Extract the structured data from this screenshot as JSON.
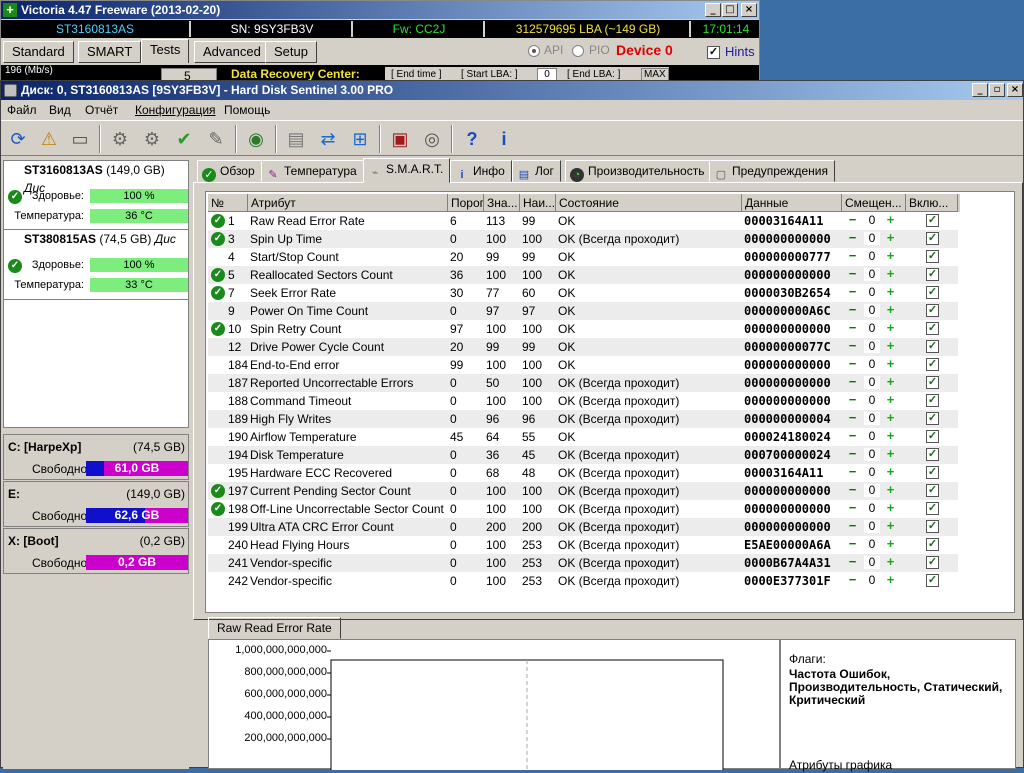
{
  "victoria": {
    "title": "Victoria 4.47  Freeware (2013-02-20)",
    "model": "ST3160813AS",
    "serial": "SN: 9SY3FB3V",
    "firmware": "Fw: CC2J",
    "lba": "312579695 LBA (~149 GB)",
    "time": "17:01:14",
    "tabs": [
      "Standard",
      "SMART",
      "Tests",
      "Advanced",
      "Setup"
    ],
    "active_tab": "Tests",
    "mode_api": "API",
    "mode_pio": "PIO",
    "device": "Device 0",
    "hints": "Hints",
    "speed_label": "196 (Mb/s)",
    "counter": "5",
    "data_recovery": "Data Recovery Center:",
    "end_time": "[ End time ]",
    "start_lba": "[ Start LBA: ]",
    "start_lba_val": "0",
    "end_lba": "[ End LBA: ]",
    "max": "MAX"
  },
  "hds": {
    "title": "Диск: 0, ST3160813AS [9SY3FB3V]  -  Hard Disk Sentinel 3.00 PRO",
    "menu": [
      "Файл",
      "Вид",
      "Отчёт",
      "Конфигурация",
      "Помощь"
    ],
    "tabs": [
      {
        "label": "Обзор",
        "icon": "check-icon"
      },
      {
        "label": "Температура",
        "icon": "thermometer-icon"
      },
      {
        "label": "S.M.A.R.T.",
        "icon": "smart-icon"
      },
      {
        "label": "Инфо",
        "icon": "info-icon"
      },
      {
        "label": "Лог",
        "icon": "log-icon"
      },
      {
        "label": "Производительность",
        "icon": "speed-icon"
      },
      {
        "label": "Предупреждения",
        "icon": "warning-icon"
      }
    ],
    "active_tab": "S.M.A.R.T.",
    "disks": [
      {
        "name": "ST3160813AS",
        "size": "(149,0 GB)",
        "extra": "Дис",
        "health_label": "Здоровье:",
        "health": "100 %",
        "temp_label": "Температура:",
        "temp": "36 °C"
      },
      {
        "name": "ST380815AS",
        "size": "(74,5 GB)",
        "extra": "Дис",
        "health_label": "Здоровье:",
        "health": "100 %",
        "temp_label": "Температура:",
        "temp": "33 °C"
      }
    ],
    "partitions": [
      {
        "letter": "C: [HarpeXp]",
        "size": "(74,5 GB)",
        "free_label": "Свободно",
        "free": "61,0 GB",
        "used_frac": 0.18
      },
      {
        "letter": "E:",
        "size": "(149,0 GB)",
        "free_label": "Свободно",
        "free": "62,6 GB",
        "used_frac": 0.58
      },
      {
        "letter": "X: [Boot]",
        "size": "(0,2 GB)",
        "free_label": "Свободно",
        "free": "0,2 GB",
        "used_frac": 0.0
      }
    ],
    "columns": [
      "№",
      "Атрибут",
      "Порог",
      "Зна...",
      "Наи...",
      "Состояние",
      "Данные",
      "Смещен...",
      "Вклю..."
    ],
    "rows": [
      {
        "ok": true,
        "id": "1",
        "name": "Raw Read Error Rate",
        "thr": "6",
        "val": "113",
        "worst": "99",
        "state": "OK",
        "data": "00003164A11",
        "off": "0"
      },
      {
        "ok": true,
        "id": "3",
        "name": "Spin Up Time",
        "thr": "0",
        "val": "100",
        "worst": "100",
        "state": "OK (Всегда проходит)",
        "data": "000000000000",
        "off": "0"
      },
      {
        "ok": false,
        "id": "4",
        "name": "Start/Stop Count",
        "thr": "20",
        "val": "99",
        "worst": "99",
        "state": "OK",
        "data": "000000000777",
        "off": "0"
      },
      {
        "ok": true,
        "id": "5",
        "name": "Reallocated Sectors Count",
        "thr": "36",
        "val": "100",
        "worst": "100",
        "state": "OK",
        "data": "000000000000",
        "off": "0"
      },
      {
        "ok": true,
        "id": "7",
        "name": "Seek Error Rate",
        "thr": "30",
        "val": "77",
        "worst": "60",
        "state": "OK",
        "data": "0000030B2654",
        "off": "0"
      },
      {
        "ok": false,
        "id": "9",
        "name": "Power On Time Count",
        "thr": "0",
        "val": "97",
        "worst": "97",
        "state": "OK",
        "data": "000000000A6C",
        "off": "0"
      },
      {
        "ok": true,
        "id": "10",
        "name": "Spin Retry Count",
        "thr": "97",
        "val": "100",
        "worst": "100",
        "state": "OK",
        "data": "000000000000",
        "off": "0"
      },
      {
        "ok": false,
        "id": "12",
        "name": "Drive Power Cycle Count",
        "thr": "20",
        "val": "99",
        "worst": "99",
        "state": "OK",
        "data": "00000000077C",
        "off": "0"
      },
      {
        "ok": false,
        "id": "184",
        "name": "End-to-End error",
        "thr": "99",
        "val": "100",
        "worst": "100",
        "state": "OK",
        "data": "000000000000",
        "off": "0"
      },
      {
        "ok": false,
        "id": "187",
        "name": "Reported Uncorrectable Errors",
        "thr": "0",
        "val": "50",
        "worst": "100",
        "state": "OK (Всегда проходит)",
        "data": "000000000000",
        "off": "0"
      },
      {
        "ok": false,
        "id": "188",
        "name": "Command Timeout",
        "thr": "0",
        "val": "100",
        "worst": "100",
        "state": "OK (Всегда проходит)",
        "data": "000000000000",
        "off": "0"
      },
      {
        "ok": false,
        "id": "189",
        "name": "High Fly Writes",
        "thr": "0",
        "val": "96",
        "worst": "96",
        "state": "OK (Всегда проходит)",
        "data": "000000000004",
        "off": "0"
      },
      {
        "ok": false,
        "id": "190",
        "name": "Airflow Temperature",
        "thr": "45",
        "val": "64",
        "worst": "55",
        "state": "OK",
        "data": "000024180024",
        "off": "0"
      },
      {
        "ok": false,
        "id": "194",
        "name": "Disk Temperature",
        "thr": "0",
        "val": "36",
        "worst": "45",
        "state": "OK (Всегда проходит)",
        "data": "000700000024",
        "off": "0"
      },
      {
        "ok": false,
        "id": "195",
        "name": "Hardware ECC Recovered",
        "thr": "0",
        "val": "68",
        "worst": "48",
        "state": "OK (Всегда проходит)",
        "data": "00003164A11",
        "off": "0"
      },
      {
        "ok": true,
        "id": "197",
        "name": "Current Pending Sector Count",
        "thr": "0",
        "val": "100",
        "worst": "100",
        "state": "OK (Всегда проходит)",
        "data": "000000000000",
        "off": "0"
      },
      {
        "ok": true,
        "id": "198",
        "name": "Off-Line Uncorrectable Sector Count",
        "thr": "0",
        "val": "100",
        "worst": "100",
        "state": "OK (Всегда проходит)",
        "data": "000000000000",
        "off": "0"
      },
      {
        "ok": false,
        "id": "199",
        "name": "Ultra ATA CRC Error Count",
        "thr": "0",
        "val": "200",
        "worst": "200",
        "state": "OK (Всегда проходит)",
        "data": "000000000000",
        "off": "0"
      },
      {
        "ok": false,
        "id": "240",
        "name": "Head Flying Hours",
        "thr": "0",
        "val": "100",
        "worst": "253",
        "state": "OK (Всегда проходит)",
        "data": "E5AE00000A6A",
        "off": "0"
      },
      {
        "ok": false,
        "id": "241",
        "name": "Vendor-specific",
        "thr": "0",
        "val": "100",
        "worst": "253",
        "state": "OK (Всегда проходит)",
        "data": "0000B67A4A31",
        "off": "0"
      },
      {
        "ok": false,
        "id": "242",
        "name": "Vendor-specific",
        "thr": "0",
        "val": "100",
        "worst": "253",
        "state": "OK (Всегда проходит)",
        "data": "0000E377301F",
        "off": "0"
      }
    ],
    "lower_tab": "Raw Read Error Rate",
    "chart_yticks": [
      "1,000,000,000,000",
      "800,000,000,000",
      "600,000,000,000",
      "400,000,000,000",
      "200,000,000,000"
    ],
    "flags_label": "Флаги:",
    "flags_value": "Частота Ошибок, Производительность, Статический, Критический",
    "chart_attrs": "Атрибуты графика"
  }
}
